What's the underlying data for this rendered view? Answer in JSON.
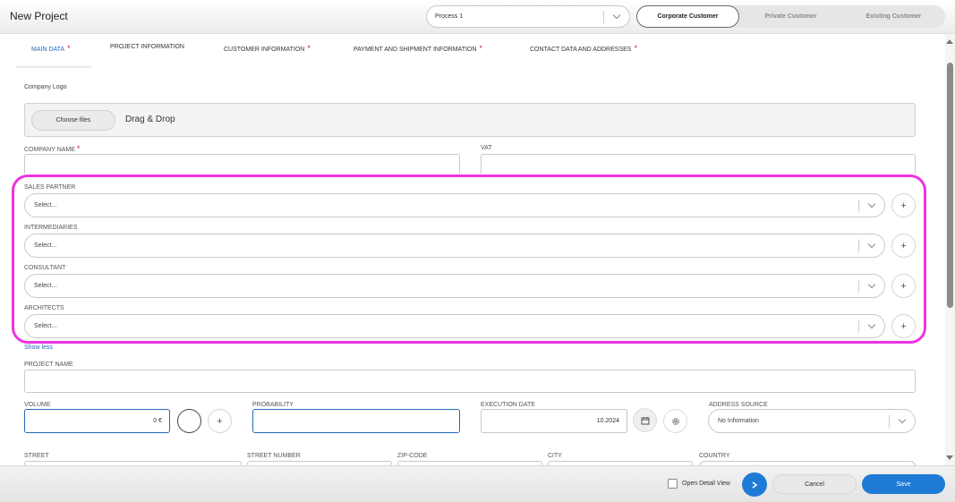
{
  "header": {
    "title": "New Project",
    "process": {
      "value": "Process 1"
    },
    "customer_types": [
      "Corporate Customer",
      "Private Customer",
      "Existing Customer"
    ]
  },
  "tabs": [
    {
      "label": "MAIN DATA",
      "required": "*"
    },
    {
      "label": "PROJECT INFORMATION",
      "required": ""
    },
    {
      "label": "CUSTOMER INFORMATION",
      "required": "*"
    },
    {
      "label": "PAYMENT AND SHIPMENT INFORMATION",
      "required": "*"
    },
    {
      "label": "CONTACT DATA AND ADDRESSES",
      "required": "*"
    }
  ],
  "form": {
    "company_logo_label": "Company Logo",
    "choose_files": "Choose files",
    "drag_drop": "Drag & Drop",
    "company_name_label": "COMPANY NAME",
    "required_mark": "*",
    "vat_label": "VAT",
    "sales_partner_label": "SALES PARTNER",
    "intermediaries_label": "INTERMEDIARIES",
    "consultant_label": "CONSULTANT",
    "architects_label": "ARCHITECTS",
    "select_placeholder": "Select...",
    "plus": "+",
    "show_less": "Show less",
    "project_name_label": "PROJECT NAME",
    "volume_label": "VOLUME",
    "volume_value": "0 €",
    "probability_label": "PROBABILITY",
    "execution_date_label": "EXECUTION DATE",
    "execution_date_value": "10.2024",
    "address_source_label": "ADDRESS SOURCE",
    "address_source_value": "No Information",
    "street_label": "STREET",
    "street_number_label": "STREET NUMBER",
    "zip_label": "ZIP-CODE",
    "city_label": "CITY",
    "country_label": "COUNTRY"
  },
  "footer": {
    "open_detail_view": "Open Detail View",
    "cancel": "Cancel",
    "save": "Save"
  },
  "icons": {
    "calendar": "calendar-icon",
    "settings": "gear-icon",
    "next": "chevron-right-icon"
  },
  "colors": {
    "accent": "#1f7ad6",
    "highlight": "#ee33e0",
    "required": "#dd2222"
  }
}
